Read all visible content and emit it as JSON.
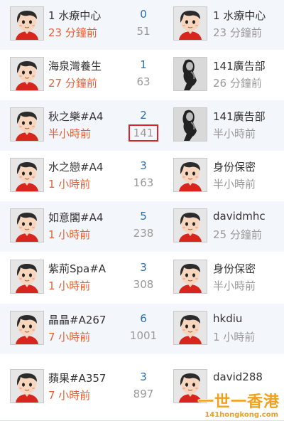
{
  "rows": [
    {
      "topic": "1 水療中心",
      "time": "23 分鐘前",
      "time_recent": true,
      "replies": "0",
      "views": "51",
      "last_user": "1 水療中心",
      "last_time": "23 分鐘前",
      "last_avatar": "cartoon",
      "highlight": false
    },
    {
      "topic": "海泉灣養生",
      "time": "27 分鐘前",
      "time_recent": true,
      "replies": "1",
      "views": "63",
      "last_user": "141廣告部",
      "last_time": "26 分鐘前",
      "last_avatar": "photo",
      "highlight": false
    },
    {
      "topic": "秋之樂#A4",
      "time": "半小時前",
      "time_recent": true,
      "replies": "2",
      "views": "141",
      "last_user": "141廣告部",
      "last_time": "半小時前",
      "last_avatar": "photo",
      "highlight": true
    },
    {
      "topic": "水之戀#A4",
      "time": "1 小時前",
      "time_recent": true,
      "replies": "3",
      "views": "163",
      "last_user": "身份保密",
      "last_time": "半小時前",
      "last_avatar": "cartoon",
      "highlight": false
    },
    {
      "topic": "如意閣#A4",
      "time": "1 小時前",
      "time_recent": true,
      "replies": "5",
      "views": "238",
      "last_user": "davidmhc",
      "last_time": "25 分鐘前",
      "last_avatar": "cartoon",
      "highlight": false
    },
    {
      "topic": "紫荊Spa#A",
      "time": "1 小時前",
      "time_recent": true,
      "replies": "3",
      "views": "308",
      "last_user": "身份保密",
      "last_time": "半小時前",
      "last_avatar": "cartoon",
      "highlight": false
    },
    {
      "topic": "晶晶#A267",
      "time": "7 小時前",
      "time_recent": true,
      "replies": "6",
      "views": "1001",
      "last_user": "hkdiu",
      "last_time": "1 小時前",
      "last_avatar": "cartoon",
      "highlight": false
    },
    {
      "topic": "蘋果#A357",
      "time": "7 小時前",
      "time_recent": true,
      "replies": "3",
      "views": "897",
      "last_user": "david288",
      "last_time": "",
      "last_avatar": "cartoon",
      "highlight": false
    }
  ],
  "watermark": {
    "title": "一世一香港",
    "url": "141hongkong.com"
  }
}
